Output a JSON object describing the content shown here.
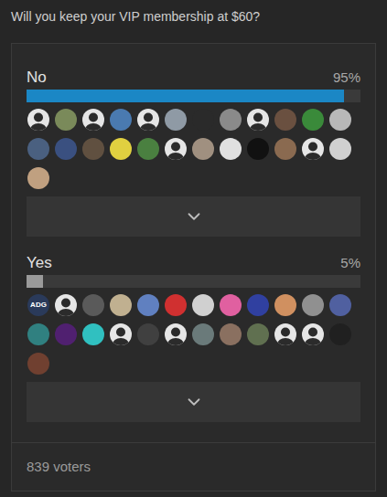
{
  "poll": {
    "question": "Will you keep your VIP membership at $60?",
    "options": [
      {
        "label": "No",
        "percent": "95%",
        "level": 0.95,
        "color": "#1b87c5",
        "avatars": [
          {
            "kind": "silhouette"
          },
          {
            "kind": "photo",
            "color": "#7a8a5a"
          },
          {
            "kind": "silhouette"
          },
          {
            "kind": "photo",
            "color": "#4a7ab0"
          },
          {
            "kind": "silhouette"
          },
          {
            "kind": "photo",
            "color": "#8f9aa5"
          },
          {
            "kind": "photo",
            "color": "#2a2a2a"
          },
          {
            "kind": "photo",
            "color": "#8a8a8a"
          },
          {
            "kind": "silhouette"
          },
          {
            "kind": "photo",
            "color": "#6a5040"
          },
          {
            "kind": "photo",
            "color": "#3a8a3a"
          },
          {
            "kind": "photo",
            "color": "#b8b8b8"
          },
          {
            "kind": "photo",
            "color": "#4a6080"
          },
          {
            "kind": "photo",
            "color": "#3a5080"
          },
          {
            "kind": "photo",
            "color": "#605040"
          },
          {
            "kind": "photo",
            "color": "#e0d040"
          },
          {
            "kind": "photo",
            "color": "#4a8040"
          },
          {
            "kind": "silhouette"
          },
          {
            "kind": "photo",
            "color": "#a09080"
          },
          {
            "kind": "photo",
            "color": "#e0e0e0"
          },
          {
            "kind": "photo",
            "color": "#111111"
          },
          {
            "kind": "photo",
            "color": "#8a6a50"
          },
          {
            "kind": "silhouette"
          },
          {
            "kind": "photo",
            "color": "#d0d0d0"
          },
          {
            "kind": "photo",
            "color": "#c0a080"
          }
        ]
      },
      {
        "label": "Yes",
        "percent": "5%",
        "level": 0.05,
        "color": "#9a9a9a",
        "avatars": [
          {
            "kind": "initials",
            "label": "ADG",
            "color": "#2a3a5a"
          },
          {
            "kind": "silhouette"
          },
          {
            "kind": "photo",
            "color": "#5a5a5a"
          },
          {
            "kind": "photo",
            "color": "#c0b090"
          },
          {
            "kind": "photo",
            "color": "#6080c0"
          },
          {
            "kind": "photo",
            "color": "#d03030"
          },
          {
            "kind": "photo",
            "color": "#d0d0d0"
          },
          {
            "kind": "photo",
            "color": "#e060a0"
          },
          {
            "kind": "photo",
            "color": "#3040a0"
          },
          {
            "kind": "photo",
            "color": "#d09060"
          },
          {
            "kind": "photo",
            "color": "#909090"
          },
          {
            "kind": "photo",
            "color": "#5060a0"
          },
          {
            "kind": "photo",
            "color": "#308080"
          },
          {
            "kind": "photo",
            "color": "#502070"
          },
          {
            "kind": "photo",
            "color": "#30c0c0"
          },
          {
            "kind": "silhouette"
          },
          {
            "kind": "photo",
            "color": "#404040"
          },
          {
            "kind": "silhouette"
          },
          {
            "kind": "photo",
            "color": "#6a7a7a"
          },
          {
            "kind": "photo",
            "color": "#8a7060"
          },
          {
            "kind": "photo",
            "color": "#607050"
          },
          {
            "kind": "silhouette"
          },
          {
            "kind": "silhouette"
          },
          {
            "kind": "photo",
            "color": "#202020"
          },
          {
            "kind": "photo",
            "color": "#704030"
          }
        ]
      }
    ],
    "voters": "839 voters"
  }
}
